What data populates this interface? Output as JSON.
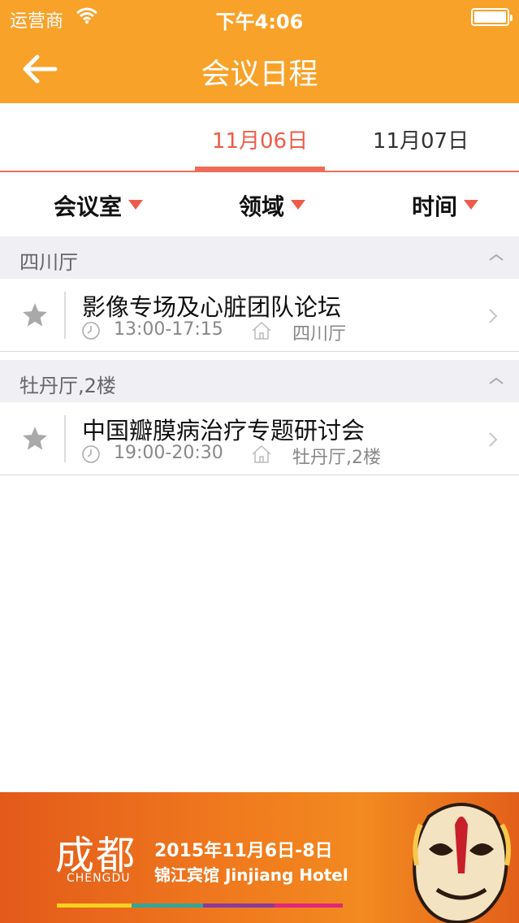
{
  "status_bar": {
    "carrier": "运营商",
    "time": "下午4:06"
  },
  "nav": {
    "title": "会议日程",
    "back_icon": "back-arrow-icon"
  },
  "date_tabs": [
    {
      "label": "11月06日",
      "active": true
    },
    {
      "label": "11月07日",
      "active": false
    }
  ],
  "filters": [
    {
      "label": "会议室"
    },
    {
      "label": "领域"
    },
    {
      "label": "时间"
    }
  ],
  "groups": [
    {
      "title": "四川厅",
      "items": [
        {
          "title": "影像专场及心脏团队论坛",
          "time": "13:00-17:15",
          "room": "四川厅"
        }
      ]
    },
    {
      "title": "牡丹厅,2楼",
      "items": [
        {
          "title": "中国瓣膜病治疗专题研讨会",
          "time": "19:00-20:30",
          "room": "牡丹厅,2楼"
        }
      ]
    }
  ],
  "banner": {
    "logo": "成都",
    "logo_sub": "CHENGDU",
    "date": "2015年11月6日-8日",
    "hotel": "锦江宾馆 Jinjiang Hotel"
  },
  "colors": {
    "header": "#f8a22a",
    "accent": "#ef5b4a",
    "group_bg": "#efeff4"
  }
}
